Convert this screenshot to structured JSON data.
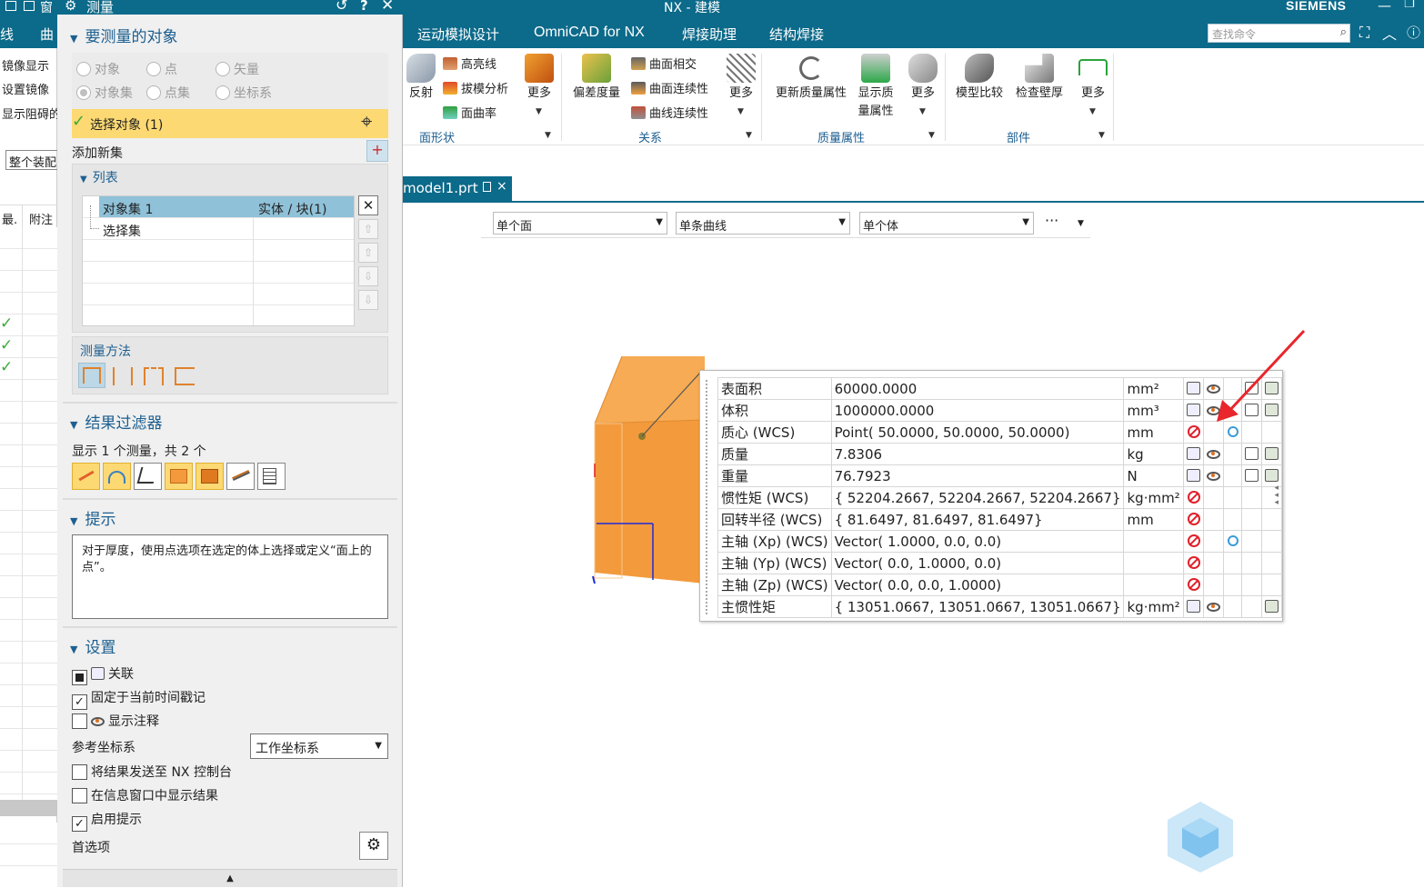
{
  "window": {
    "title": "NX - 建模",
    "brand": "SIEMENS"
  },
  "tabs": [
    "运动模拟设计",
    "OmniCAD for NX",
    "焊接助理",
    "结构焊接"
  ],
  "search": {
    "placeholder": "查找命令"
  },
  "left_strip": {
    "top_labels": [
      "线",
      "曲"
    ],
    "items": [
      "镜像显示",
      "设置镜像",
      "显示阻碍的"
    ],
    "dropdown": "整个装配",
    "columns": [
      "最.",
      "附注"
    ]
  },
  "ribbon": {
    "face_shape": {
      "label": "面形状",
      "reflect": "反射",
      "small": [
        "高亮线",
        "拔模分析",
        "面曲率"
      ],
      "more": "更多"
    },
    "relation": {
      "label": "关系",
      "deviation": "偏差度量",
      "small": [
        "曲面相交",
        "曲面连续性",
        "曲线连续性"
      ],
      "more": "更多"
    },
    "mass": {
      "label": "质量属性",
      "update": "更新质量属性",
      "show_line1": "显示质",
      "show_line2": "量属性",
      "more": "更多"
    },
    "part": {
      "label": "部件",
      "compare": "模型比较",
      "thickness": "检查壁厚",
      "more": "更多"
    }
  },
  "doc_tab": {
    "name": "model1.prt"
  },
  "filters": [
    "单个面",
    "单条曲线",
    "单个体"
  ],
  "dialog": {
    "title": "测量",
    "sections": {
      "objects": "要测量的对象",
      "result_filter": "结果过滤器",
      "hint": "提示",
      "settings": "设置"
    },
    "radios": [
      "对象",
      "点",
      "矢量",
      "对象集",
      "点集",
      "坐标系"
    ],
    "select_label": "选择对象 (1)",
    "add_new_set": "添加新集",
    "list_label": "列表",
    "list_rows": [
      [
        "对象集 1",
        "实体 / 块(1)"
      ],
      [
        "选择集",
        ""
      ]
    ],
    "method_label": "测量方法",
    "filter_summary": "显示 1 个测量，共 2 个",
    "hint_text": "对于厚度，使用点选项在选定的体上选择或定义“面上的点”。",
    "settings": {
      "associative": "关联",
      "fix_timestamp": "固定于当前时间戳记",
      "show_annotation": "显示注释",
      "ref_csys_label": "参考坐标系",
      "ref_csys_value": "工作坐标系",
      "send_console": "将结果发送至 NX 控制台",
      "show_info": "在信息窗口中显示结果",
      "enable_hints": "启用提示",
      "preferences": "首选项"
    }
  },
  "results": [
    {
      "name": "表面积",
      "value": "60000.0000",
      "unit": "mm²",
      "icons": [
        "attr",
        "eye",
        "",
        "copy",
        "export"
      ]
    },
    {
      "name": "体积",
      "value": "1000000.0000",
      "unit": "mm³",
      "icons": [
        "attr",
        "eye",
        "",
        "copy",
        "export"
      ]
    },
    {
      "name": "质心 (WCS)",
      "value": "Point( 50.0000, 50.0000, 50.0000)",
      "unit": "mm",
      "icons": [
        "forbid",
        "",
        "loupe",
        "",
        ""
      ]
    },
    {
      "name": "质量",
      "value": "7.8306",
      "unit": "kg",
      "icons": [
        "attr",
        "eye",
        "",
        "copy",
        "export"
      ]
    },
    {
      "name": "重量",
      "value": "76.7923",
      "unit": "N",
      "icons": [
        "attr",
        "eye",
        "",
        "copy",
        "export"
      ]
    },
    {
      "name": "惯性矩 (WCS)",
      "value": "{ 52204.2667, 52204.2667, 52204.2667}",
      "unit": "kg·mm²",
      "icons": [
        "forbid",
        "",
        "",
        "",
        ""
      ]
    },
    {
      "name": "回转半径 (WCS)",
      "value": "{ 81.6497, 81.6497, 81.6497}",
      "unit": "mm",
      "icons": [
        "forbid",
        "",
        "",
        "",
        ""
      ]
    },
    {
      "name": "主轴 (Xp) (WCS)",
      "value": "Vector( 1.0000, 0.0, 0.0)",
      "unit": "",
      "icons": [
        "forbid",
        "",
        "loupe",
        "",
        ""
      ]
    },
    {
      "name": "主轴 (Yp) (WCS)",
      "value": "Vector( 0.0, 1.0000, 0.0)",
      "unit": "",
      "icons": [
        "forbid",
        "",
        "",
        "",
        ""
      ]
    },
    {
      "name": "主轴 (Zp) (WCS)",
      "value": "Vector( 0.0, 0.0, 1.0000)",
      "unit": "",
      "icons": [
        "forbid",
        "",
        "",
        "",
        ""
      ]
    },
    {
      "name": "主惯性矩",
      "value": "{ 13051.0667, 13051.0667, 13051.0667}",
      "unit": "kg·mm²",
      "icons": [
        "attr",
        "eye",
        "",
        "",
        "export"
      ]
    }
  ],
  "colors": {
    "title_bar": "#0c6a8a",
    "highlight": "#fcd973",
    "list_select": "#8fc1d8",
    "part": "#f39a3c",
    "annotation_arrow": "#e8262c"
  }
}
